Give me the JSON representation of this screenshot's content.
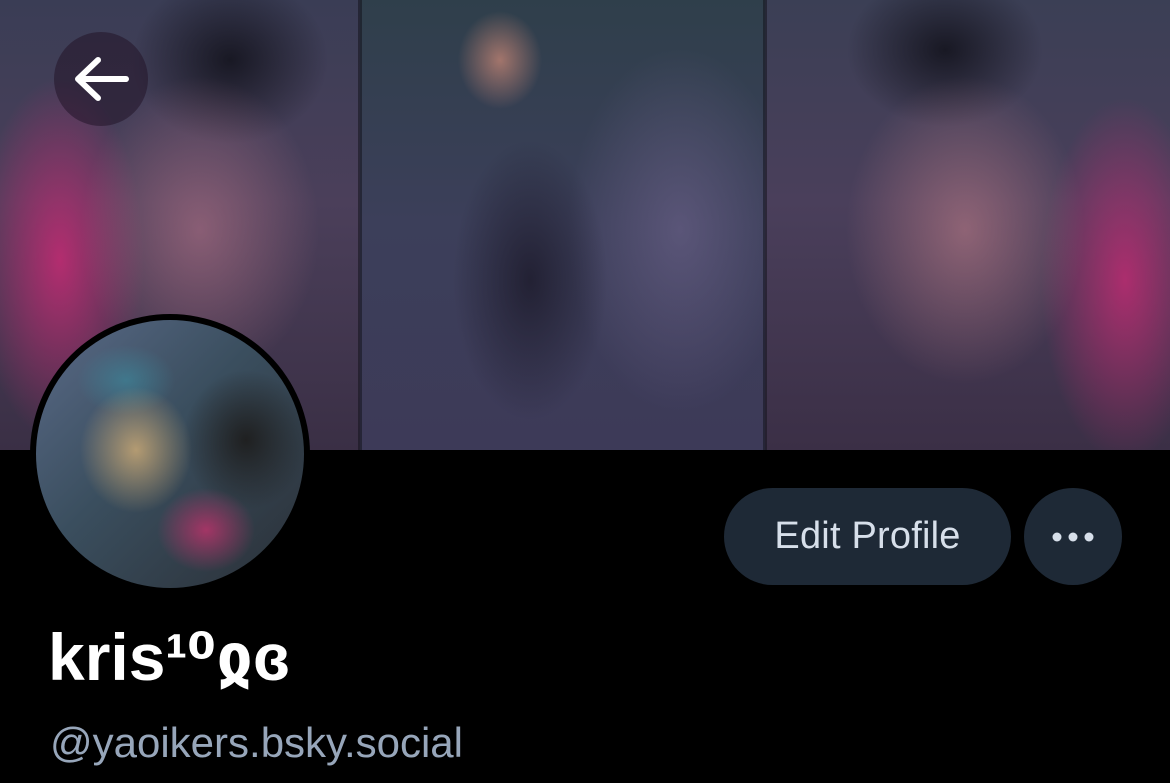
{
  "banner": {
    "back_icon": "arrow-left-icon"
  },
  "profile": {
    "display_name": "kris¹⁰ჲɞ",
    "handle": "@yaoikers.bsky.social"
  },
  "actions": {
    "edit_profile_label": "Edit Profile",
    "more_icon": "ellipsis-icon"
  },
  "colors": {
    "background": "#000000",
    "button_background": "#1e2936",
    "button_text": "#d7dfea",
    "handle_text": "#97a6ba",
    "name_text": "#ffffff"
  }
}
